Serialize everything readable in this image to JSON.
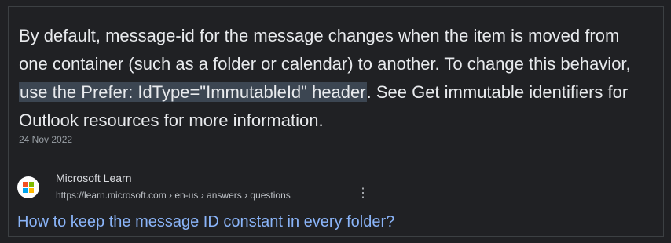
{
  "snippet": {
    "text_before": "By default, message-id for the message changes when the item is moved from one container (such as a folder or calendar) to another. To change this behavior, ",
    "highlight_text": "use the Prefer: IdType=\"ImmutableId\" header",
    "text_after": ". See Get immutable identifiers for Outlook resources for more information.",
    "date": "24 Nov 2022"
  },
  "result": {
    "site_name": "Microsoft Learn",
    "breadcrumb": "https://learn.microsoft.com › en-us › answers › questions",
    "title": "How to keep the message ID constant in every folder?",
    "menu_icon": "⋮",
    "favicon_icon": "microsoft-logo-icon"
  },
  "colors": {
    "background": "#202124",
    "snippet_text": "#e8eaed",
    "highlight": "#3c4652",
    "title_link": "#8ab4f8",
    "muted_text": "#9aa0a6"
  }
}
